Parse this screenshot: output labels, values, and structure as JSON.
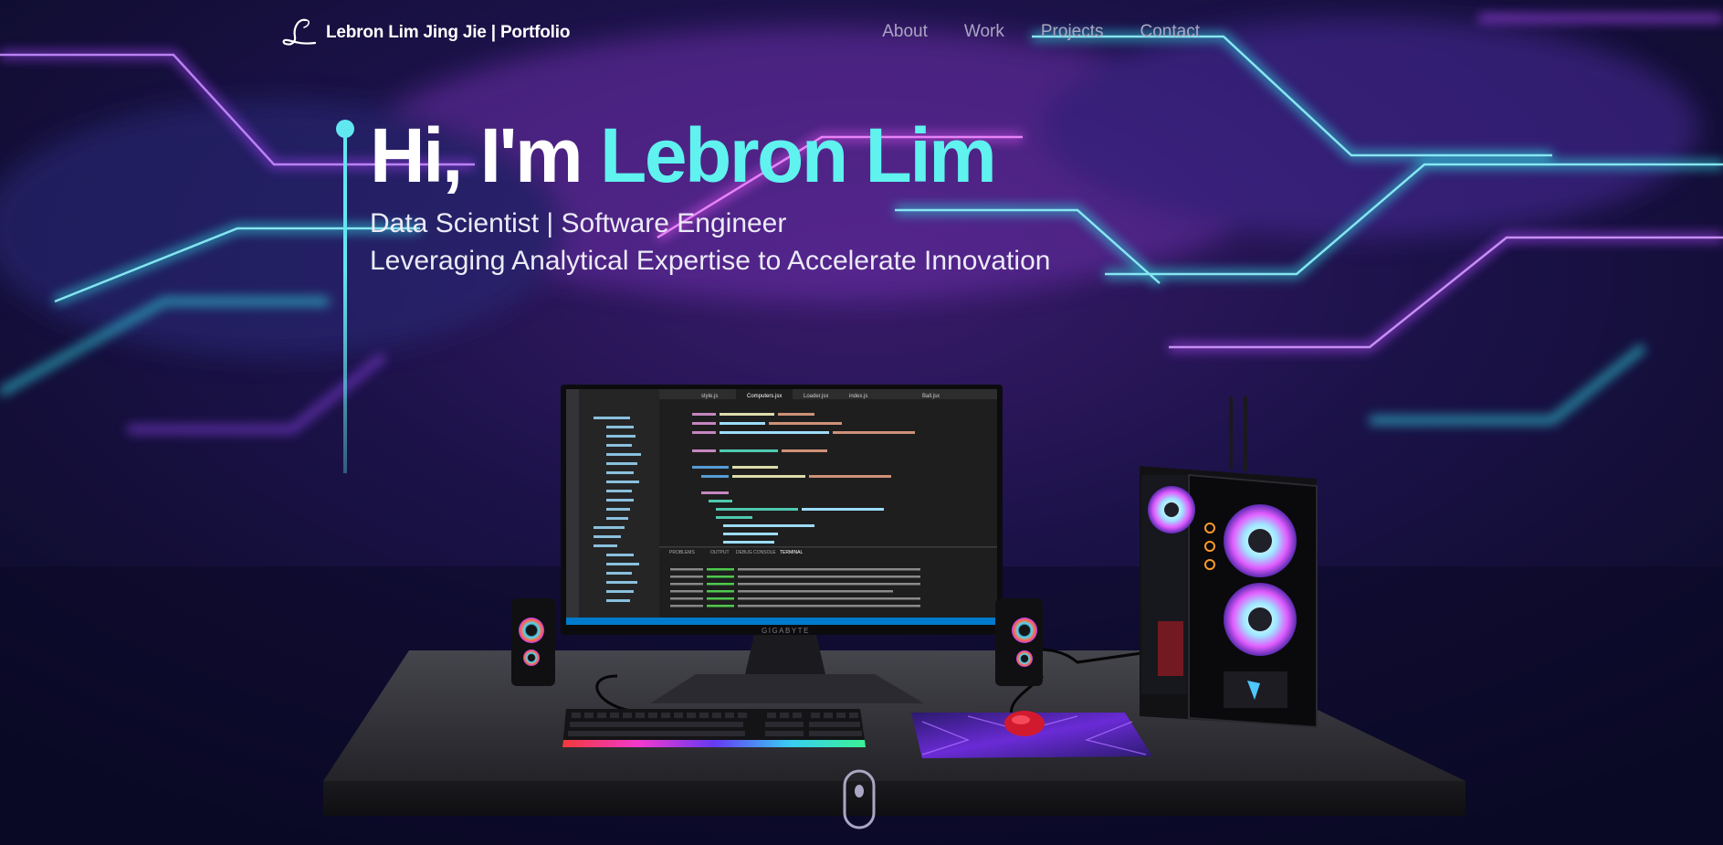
{
  "nav": {
    "brand_text": "Lebron Lim Jing Jie | Portfolio",
    "links": [
      "About",
      "Work",
      "Projects",
      "Contact"
    ]
  },
  "hero": {
    "title_prefix": "Hi, I'm ",
    "title_name": "Lebron Lim",
    "subtitle_line1": "Data Scientist | Software Engineer",
    "subtitle_line2": "Leveraging Analytical Expertise to Accelerate Innovation"
  },
  "monitor": {
    "brand": "GIGABYTE",
    "tabs": [
      "style.js",
      "Computers.jsx",
      "Loader.jsx",
      "index.js",
      "Ball.jsx"
    ],
    "panel_tabs": [
      "PROBLEMS",
      "OUTPUT",
      "DEBUG CONSOLE",
      "TERMINAL"
    ]
  },
  "colors": {
    "accent": "#5ff2ef",
    "nav_text": "#aaa6c3",
    "background": "#0b0a26"
  }
}
